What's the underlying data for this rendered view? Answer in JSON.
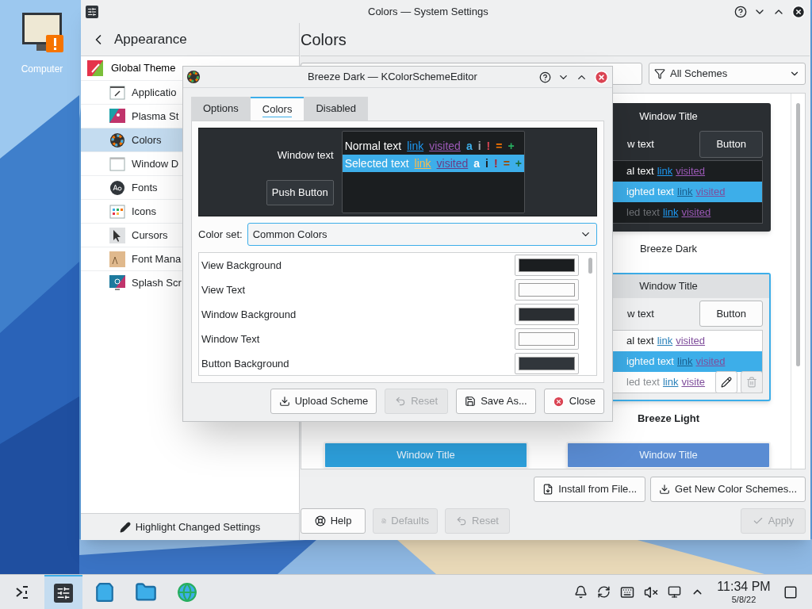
{
  "desktop": {
    "icons": [
      {
        "label": "Computer"
      }
    ]
  },
  "settings_window": {
    "title": "Colors — System Settings",
    "sidebar": {
      "back_label": "Appearance",
      "items": [
        {
          "label": "Global Theme",
          "selected": false,
          "children": [
            {
              "label": "Applicatio",
              "selected": false
            },
            {
              "label": "Plasma St",
              "selected": false
            },
            {
              "label": "Colors",
              "selected": true
            },
            {
              "label": "Window D",
              "selected": false
            },
            {
              "label": "Fonts",
              "selected": false
            },
            {
              "label": "Icons",
              "selected": false
            },
            {
              "label": "Cursors",
              "selected": false
            },
            {
              "label": "Font Mana",
              "selected": false
            },
            {
              "label": "Splash Scr",
              "selected": false
            }
          ]
        }
      ],
      "highlight_button": "Highlight Changed Settings"
    },
    "page_title": "Colors",
    "filter": "All Schemes",
    "schemes": [
      {
        "kind": "dark",
        "color": "#2a2e32",
        "window_title": "Window Title",
        "window_text": "w text",
        "button": "Button",
        "normal_text": "al text",
        "link": "link",
        "visited": "visited",
        "highlighted_text": "ighted text",
        "highlight_link": "link",
        "highlight_visited": "visited",
        "inactive_text": "led text",
        "inactive_link": "link",
        "inactive_visited": "visited",
        "name": "Breeze Dark",
        "selected": false
      },
      {
        "kind": "light",
        "color": "#dee0e2",
        "window_title": "Window Title",
        "window_text": "w text",
        "button": "Button",
        "normal_text": "al text",
        "link": "link",
        "visited": "visited",
        "highlighted_text": "ighted text",
        "highlight_link": "link",
        "highlight_visited": "visited",
        "inactive_text": "led text",
        "inactive_link": "link",
        "inactive_visited": "visite",
        "name": "Breeze Light",
        "selected": true
      },
      {
        "kind": "light",
        "color": "#2d9fdb",
        "window_title": "Window Title",
        "selected": false
      },
      {
        "kind": "light",
        "color": "#5a8cd3",
        "window_title": "Window Title",
        "selected": false
      }
    ],
    "actions": [
      {
        "label": "Install from File...",
        "disabled": false
      },
      {
        "label": "Get New Color Schemes...",
        "disabled": false
      }
    ],
    "footer": {
      "help": {
        "label": "Help",
        "disabled": false
      },
      "defaults": {
        "label": "Defaults",
        "disabled": true
      },
      "reset": {
        "label": "Reset",
        "disabled": true
      },
      "apply": {
        "label": "Apply",
        "disabled": true
      }
    }
  },
  "dialog": {
    "title": "Breeze Dark — KColorSchemeEditor",
    "tabs": [
      {
        "label": "Options",
        "selected": false
      },
      {
        "label": "Colors",
        "selected": true
      },
      {
        "label": "Disabled",
        "selected": false
      }
    ],
    "preview": {
      "window_text": "Window text",
      "push_button": "Push Button",
      "normal_row": [
        {
          "text": "Normal text",
          "kind": "text"
        },
        {
          "text": "link",
          "kind": "link"
        },
        {
          "text": "visited",
          "kind": "visited"
        },
        {
          "text": "a",
          "color": "#3daee9"
        },
        {
          "text": "i",
          "color": "#a1a9b1"
        },
        {
          "text": "!",
          "color": "#da4453"
        },
        {
          "text": "=",
          "color": "#f67400"
        },
        {
          "text": "+",
          "color": "#27ae60"
        }
      ],
      "selected_row": [
        {
          "text": "Selected text",
          "kind": "text"
        },
        {
          "text": "link",
          "kind": "link"
        },
        {
          "text": "visited",
          "kind": "visited"
        },
        {
          "text": "a",
          "color": "#fcfcfc"
        },
        {
          "text": "i",
          "color": "#1b1e20"
        },
        {
          "text": "!",
          "color": "#a8232f"
        },
        {
          "text": "=",
          "color": "#9a4800"
        },
        {
          "text": "+",
          "color": "#1a6b3c"
        }
      ]
    },
    "color_set_label": "Color set:",
    "color_set": "Common Colors",
    "colors": [
      {
        "name": "View Background",
        "color": "#1b1e20"
      },
      {
        "name": "View Text",
        "color": "#fcfcfc"
      },
      {
        "name": "Window Background",
        "color": "#2a2e32"
      },
      {
        "name": "Window Text",
        "color": "#fcfcfc"
      },
      {
        "name": "Button Background",
        "color": "#31363b"
      }
    ],
    "buttons": [
      {
        "label": "Upload Scheme",
        "kind": "upload",
        "disabled": false
      },
      {
        "label": "Reset",
        "kind": "reset",
        "disabled": true
      },
      {
        "label": "Save As...",
        "kind": "save",
        "disabled": false
      },
      {
        "label": "Close",
        "kind": "close",
        "disabled": false
      }
    ]
  },
  "taskbar": {
    "tasks": [
      {
        "selected": false
      },
      {
        "selected": true
      },
      {
        "selected": false
      },
      {
        "selected": false
      },
      {
        "selected": false
      }
    ],
    "time": "11:34 PM",
    "date": "5/8/22"
  }
}
